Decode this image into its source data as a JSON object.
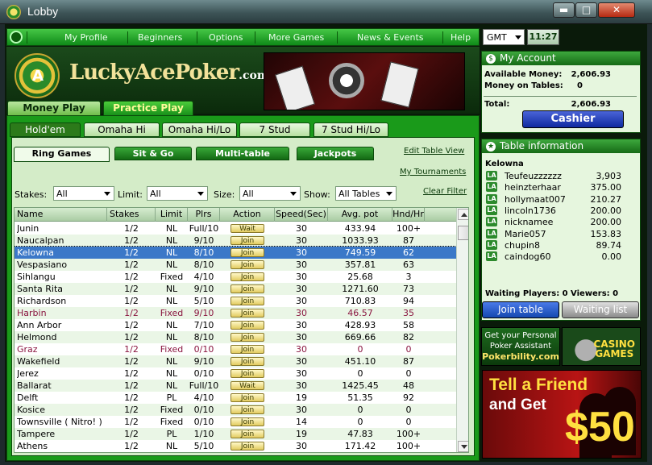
{
  "window": {
    "title": "Lobby",
    "min": "▬",
    "max": "□",
    "close": "✕"
  },
  "nav": [
    "My Profile",
    "Beginners",
    "Options",
    "More Games",
    "News & Events",
    "Help"
  ],
  "timezone": "GMT",
  "clock": "11:27",
  "logo": {
    "main": "LuckyAcePoker",
    "suffix": ".com",
    "coin_letter": "A"
  },
  "modes": {
    "money": "Money Play",
    "practice": "Practice Play"
  },
  "game_tabs": [
    "Hold'em",
    "Omaha Hi",
    "Omaha Hi/Lo",
    "7 Stud",
    "7 Stud Hi/Lo"
  ],
  "sub_tabs": [
    "Ring Games",
    "Sit & Go",
    "Multi-table",
    "Jackpots"
  ],
  "links": {
    "edit_table_view": "Edit Table View",
    "my_tournaments": "My Tournaments",
    "clear_filter": "Clear Filter"
  },
  "filters": {
    "stakes_label": "Stakes:",
    "stakes_value": "All",
    "limit_label": "Limit:",
    "limit_value": "All",
    "size_label": "Size:",
    "size_value": "All",
    "show_label": "Show:",
    "show_value": "All Tables"
  },
  "columns": [
    "Name",
    "Stakes",
    "Limit",
    "Plrs",
    "Action",
    "Speed(Sec)",
    "Avg. pot",
    "Hnd/Hr"
  ],
  "rows": [
    {
      "name": "Junin",
      "stakes": "1/2",
      "limit": "NL",
      "plrs": "Full/10",
      "action": "Wait",
      "speed": "30",
      "pot": "433.94",
      "hnd": "100+",
      "state": "normal"
    },
    {
      "name": "Naucalpan",
      "stakes": "1/2",
      "limit": "NL",
      "plrs": "9/10",
      "action": "Join",
      "speed": "30",
      "pot": "1033.93",
      "hnd": "87",
      "state": "normal"
    },
    {
      "name": "Kelowna",
      "stakes": "1/2",
      "limit": "NL",
      "plrs": "8/10",
      "action": "Join",
      "speed": "30",
      "pot": "749.59",
      "hnd": "62",
      "state": "selected"
    },
    {
      "name": "Vespasiano",
      "stakes": "1/2",
      "limit": "NL",
      "plrs": "8/10",
      "action": "Join",
      "speed": "30",
      "pot": "357.81",
      "hnd": "63",
      "state": "normal"
    },
    {
      "name": "Sihlangu",
      "stakes": "1/2",
      "limit": "Fixed",
      "plrs": "4/10",
      "action": "Join",
      "speed": "30",
      "pot": "25.68",
      "hnd": "3",
      "state": "normal"
    },
    {
      "name": "Santa Rita",
      "stakes": "1/2",
      "limit": "NL",
      "plrs": "9/10",
      "action": "Join",
      "speed": "30",
      "pot": "1271.60",
      "hnd": "73",
      "state": "normal"
    },
    {
      "name": "Richardson",
      "stakes": "1/2",
      "limit": "NL",
      "plrs": "5/10",
      "action": "Join",
      "speed": "30",
      "pot": "710.83",
      "hnd": "94",
      "state": "normal"
    },
    {
      "name": "Harbin",
      "stakes": "1/2",
      "limit": "Fixed",
      "plrs": "9/10",
      "action": "Join",
      "speed": "30",
      "pot": "46.57",
      "hnd": "35",
      "state": "closed"
    },
    {
      "name": "Ann Arbor",
      "stakes": "1/2",
      "limit": "NL",
      "plrs": "7/10",
      "action": "Join",
      "speed": "30",
      "pot": "428.93",
      "hnd": "58",
      "state": "normal"
    },
    {
      "name": "Helmond",
      "stakes": "1/2",
      "limit": "NL",
      "plrs": "8/10",
      "action": "Join",
      "speed": "30",
      "pot": "669.66",
      "hnd": "82",
      "state": "normal"
    },
    {
      "name": "Graz",
      "stakes": "1/2",
      "limit": "Fixed",
      "plrs": "0/10",
      "action": "Join",
      "speed": "30",
      "pot": "0",
      "hnd": "0",
      "state": "closed"
    },
    {
      "name": "Wakefield",
      "stakes": "1/2",
      "limit": "NL",
      "plrs": "9/10",
      "action": "Join",
      "speed": "30",
      "pot": "451.10",
      "hnd": "87",
      "state": "normal"
    },
    {
      "name": "Jerez",
      "stakes": "1/2",
      "limit": "NL",
      "plrs": "0/10",
      "action": "Join",
      "speed": "30",
      "pot": "0",
      "hnd": "0",
      "state": "normal"
    },
    {
      "name": "Ballarat",
      "stakes": "1/2",
      "limit": "NL",
      "plrs": "Full/10",
      "action": "Wait",
      "speed": "30",
      "pot": "1425.45",
      "hnd": "48",
      "state": "normal"
    },
    {
      "name": "Delft",
      "stakes": "1/2",
      "limit": "PL",
      "plrs": "4/10",
      "action": "Join",
      "speed": "19",
      "pot": "51.35",
      "hnd": "92",
      "state": "normal"
    },
    {
      "name": "Kosice",
      "stakes": "1/2",
      "limit": "Fixed",
      "plrs": "0/10",
      "action": "Join",
      "speed": "30",
      "pot": "0",
      "hnd": "0",
      "state": "normal"
    },
    {
      "name": "Townsville ( Nitro! )",
      "stakes": "1/2",
      "limit": "Fixed",
      "plrs": "0/10",
      "action": "Join",
      "speed": "14",
      "pot": "0",
      "hnd": "0",
      "state": "normal"
    },
    {
      "name": "Tampere",
      "stakes": "1/2",
      "limit": "PL",
      "plrs": "1/10",
      "action": "Join",
      "speed": "19",
      "pot": "47.83",
      "hnd": "100+",
      "state": "normal"
    },
    {
      "name": "Athens",
      "stakes": "1/2",
      "limit": "NL",
      "plrs": "5/10",
      "action": "Join",
      "speed": "30",
      "pot": "171.42",
      "hnd": "100+",
      "state": "normal"
    }
  ],
  "account": {
    "title": "My Account",
    "available_label": "Available Money:",
    "available": "2,606.93",
    "on_tables_label": "Money on Tables:",
    "on_tables": "0",
    "total_label": "Total:",
    "total": "2,606.93",
    "cashier": "Cashier"
  },
  "table_info": {
    "title": "Table information",
    "table_name": "Kelowna",
    "badge": "LA",
    "players": [
      {
        "name": "Teufeuzzzzzz",
        "chips": "3,903"
      },
      {
        "name": "heinzterhaar",
        "chips": "375.00"
      },
      {
        "name": "hollymaat007",
        "chips": "210.27"
      },
      {
        "name": "lincoln1736",
        "chips": "200.00"
      },
      {
        "name": "nicknamee",
        "chips": "200.00"
      },
      {
        "name": "Marie057",
        "chips": "153.83"
      },
      {
        "name": "chupin8",
        "chips": "89.74"
      },
      {
        "name": "caindog60",
        "chips": "0.00"
      }
    ],
    "waiting_label": "Waiting Players: 0",
    "viewers_label": "Viewers: 0",
    "join_button": "Join table",
    "waiting_list_button": "Waiting list"
  },
  "ads": {
    "assistant_line1": "Get your Personal",
    "assistant_line2": "Poker Assistant",
    "assistant_brand": "Pokerbility.com",
    "casino_line1": "CASINO",
    "casino_line2": "GAMES",
    "friend_line1": "Tell a Friend",
    "friend_line2": "and Get",
    "friend_amount": "$50"
  }
}
